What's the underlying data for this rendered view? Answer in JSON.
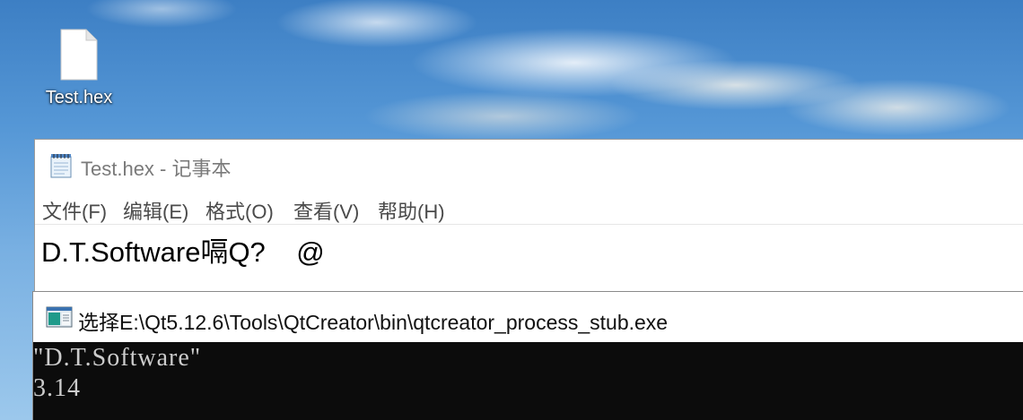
{
  "desktop": {
    "icons": [
      {
        "label": "Test.hex",
        "icon": "blank-file-icon"
      }
    ]
  },
  "notepad": {
    "icon": "notepad-app-icon",
    "title": "Test.hex - 记事本",
    "menu": [
      {
        "label": "文件(F)"
      },
      {
        "label": "编辑(E)"
      },
      {
        "label": "格式(O)"
      },
      {
        "label": "查看(V)"
      },
      {
        "label": "帮助(H)"
      }
    ],
    "content": "D.T.Software嗝Q?    @"
  },
  "console": {
    "icon": "console-app-icon",
    "title": "选择E:\\Qt5.12.6\\Tools\\QtCreator\\bin\\qtcreator_process_stub.exe",
    "lines": [
      "\"D.T.Software\"",
      "3.14"
    ],
    "colors": {
      "background": "#0c0c0c",
      "text": "#cccccc"
    }
  }
}
